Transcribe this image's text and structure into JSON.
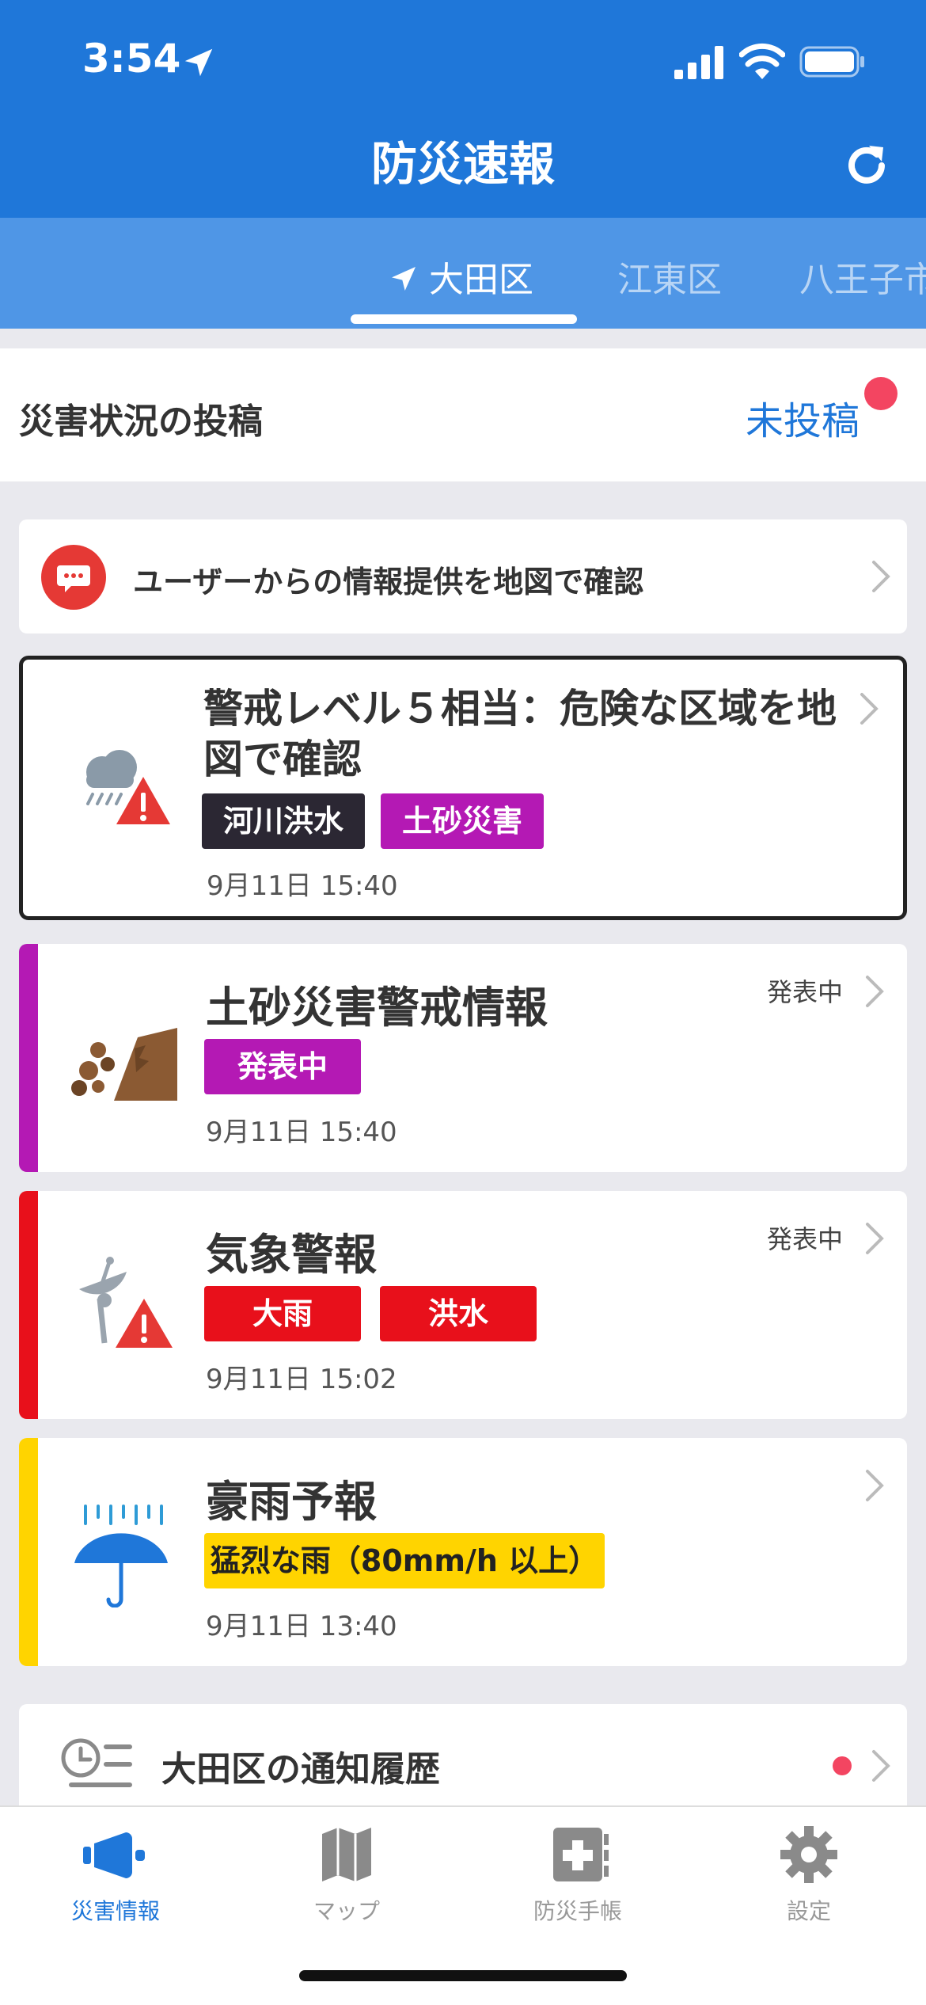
{
  "status_bar": {
    "time": "3:54"
  },
  "header": {
    "title": "防災速報"
  },
  "tabs": [
    {
      "label": "大田区",
      "active": true
    },
    {
      "label": "江東区",
      "active": false
    },
    {
      "label": "八王子市",
      "active": false
    }
  ],
  "post": {
    "label": "災害状況の投稿",
    "status": "未投稿"
  },
  "user_info": {
    "text": "ユーザーからの情報提供を地図で確認"
  },
  "level_alert": {
    "title": "警戒レベル５相当：危険な区域を地図で確認",
    "tags": [
      {
        "label": "河川洪水",
        "color": "#2b2733"
      },
      {
        "label": "土砂災害",
        "color": "#b419b4"
      }
    ],
    "date": "9月11日 15:40"
  },
  "landslide": {
    "title": "土砂災害警戒情報",
    "state": "発表中",
    "tag": "発表中",
    "date": "9月11日 15:40",
    "accent": "#b419b4"
  },
  "weather_warning": {
    "title": "気象警報",
    "state": "発表中",
    "tags": [
      "大雨",
      "洪水"
    ],
    "date": "9月11日 15:02",
    "accent": "#e8101b"
  },
  "heavy_rain": {
    "title": "豪雨予報",
    "tag": "猛烈な雨（80mm/h 以上）",
    "date": "9月11日 13:40",
    "accent": "#ffd400"
  },
  "history": {
    "label": "大田区の通知履歴"
  },
  "nav": [
    {
      "label": "災害情報",
      "icon": "megaphone-icon",
      "active": true
    },
    {
      "label": "マップ",
      "icon": "map-icon",
      "active": false
    },
    {
      "label": "防災手帳",
      "icon": "notebook-icon",
      "active": false
    },
    {
      "label": "設定",
      "icon": "gear-icon",
      "active": false
    }
  ]
}
